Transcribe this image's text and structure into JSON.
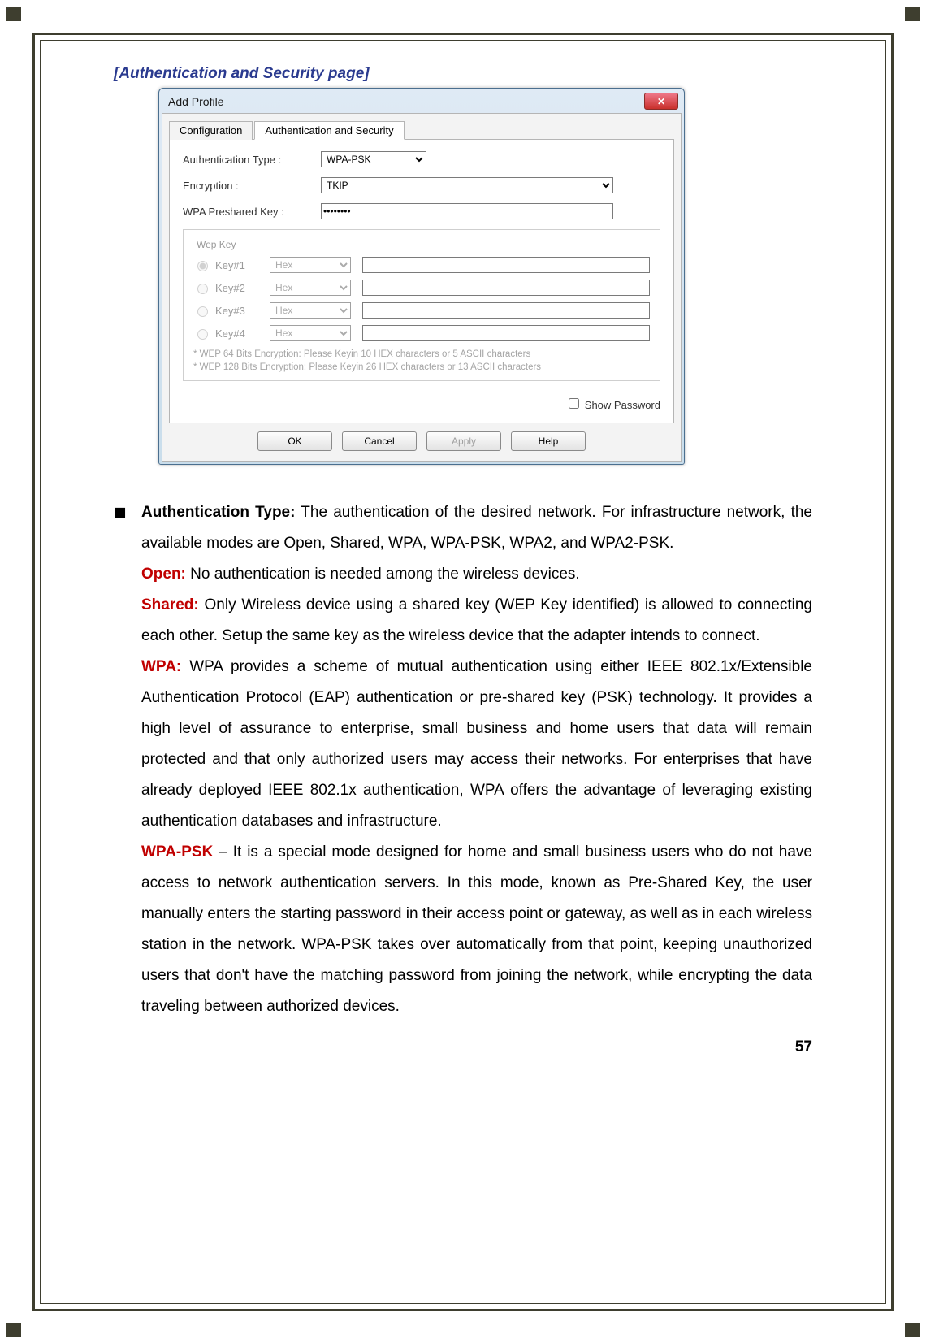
{
  "section_title": "[Authentication and Security page]",
  "dialog": {
    "title": "Add Profile",
    "tabs": [
      "Configuration",
      "Authentication and Security"
    ],
    "active_tab": 1,
    "fields": {
      "auth_label": "Authentication Type :",
      "auth_value": "WPA-PSK",
      "enc_label": "Encryption :",
      "enc_value": "TKIP",
      "psk_label": "WPA Preshared Key :",
      "psk_value": "••••••••"
    },
    "wep_group": {
      "legend": "Wep Key",
      "keys": [
        {
          "label": "Key#1",
          "format": "Hex",
          "value": "",
          "selected": true
        },
        {
          "label": "Key#2",
          "format": "Hex",
          "value": "",
          "selected": false
        },
        {
          "label": "Key#3",
          "format": "Hex",
          "value": "",
          "selected": false
        },
        {
          "label": "Key#4",
          "format": "Hex",
          "value": "",
          "selected": false
        }
      ],
      "hint1": "* WEP 64 Bits Encryption:  Please Keyin 10 HEX characters or 5 ASCII characters",
      "hint2": "* WEP 128 Bits Encryption:  Please Keyin 26 HEX characters or 13 ASCII characters"
    },
    "show_password_label": "Show Password",
    "buttons": {
      "ok": "OK",
      "cancel": "Cancel",
      "apply": "Apply",
      "help": "Help"
    }
  },
  "doc": {
    "bullet_intro_bold": "Authentication Type:",
    "bullet_intro_rest": " The authentication of the desired network. For infrastructure network, the available modes are Open, Shared, WPA, WPA-PSK, WPA2, and WPA2-PSK.",
    "defs": [
      {
        "term": "Open:",
        "text": " No authentication is needed among the wireless devices."
      },
      {
        "term": "Shared:",
        "text": " Only Wireless device using a shared key (WEP Key identified) is allowed to connecting each other. Setup the same key as the wireless device that the adapter intends to connect."
      },
      {
        "term": "WPA:",
        "text": " WPA provides a scheme of mutual authentication using either IEEE 802.1x/Extensible Authentication Protocol (EAP) authentication or pre-shared key (PSK) technology. It provides a high level of assurance to enterprise, small business and home users that data will remain protected and that only authorized users may access their networks. For enterprises that have already deployed IEEE 802.1x authentication, WPA offers the advantage of leveraging existing authentication databases and infrastructure."
      },
      {
        "term": "WPA-PSK",
        "text": " – It is a special mode designed for home and small business users who do not have access to network authentication servers. In this mode, known as Pre-Shared Key, the user manually enters the starting password in their access point or gateway, as well as in each wireless station in the network. WPA-PSK takes over automatically from that point, keeping unauthorized users that don't have the matching password from joining the network, while encrypting the data traveling between authorized devices."
      }
    ]
  },
  "page_number": "57"
}
